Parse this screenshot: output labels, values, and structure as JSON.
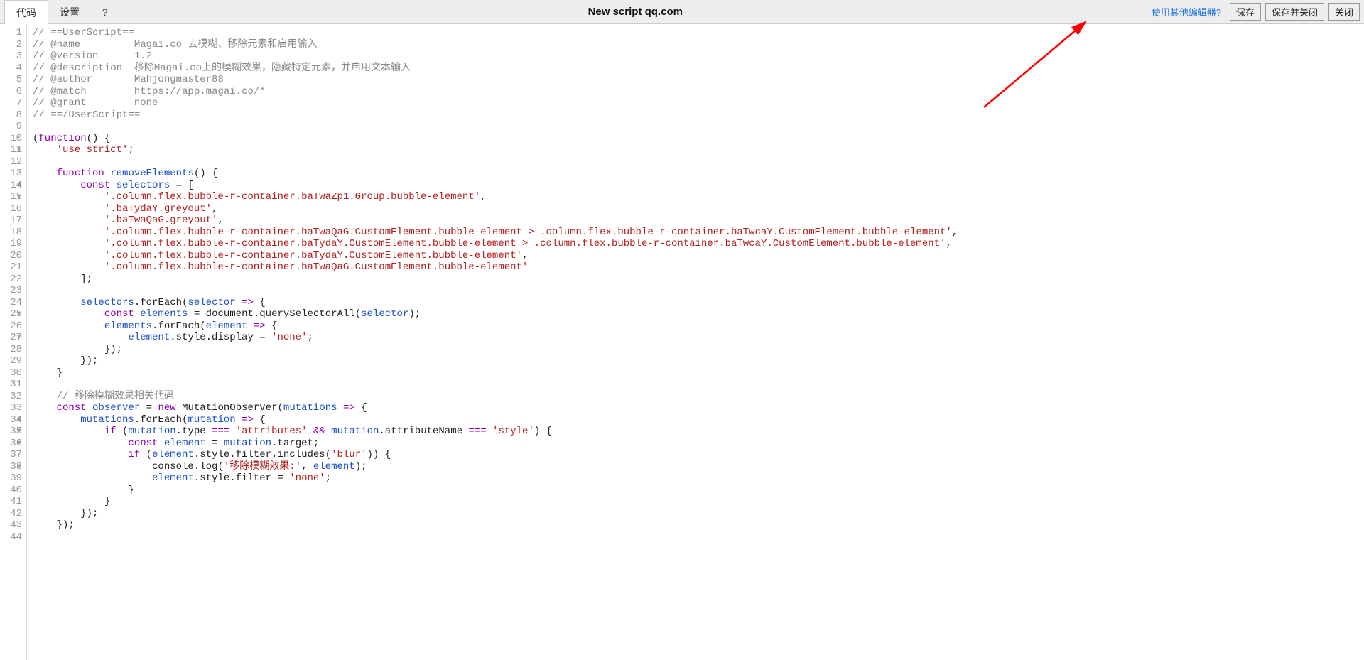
{
  "toolbar": {
    "tab_code": "代码",
    "tab_settings": "设置",
    "tab_help": "?",
    "title": "New script qq.com",
    "alt_editor_link": "使用其他编辑器?",
    "btn_save": "保存",
    "btn_save_close": "保存并关闭",
    "btn_close": "关闭"
  },
  "lines": [
    {
      "n": 1,
      "fold": false,
      "tokens": [
        [
          "com",
          "// ==UserScript=="
        ]
      ]
    },
    {
      "n": 2,
      "fold": false,
      "tokens": [
        [
          "com",
          "// @name         Magai.co 去模糊、移除元素和启用输入"
        ]
      ]
    },
    {
      "n": 3,
      "fold": false,
      "tokens": [
        [
          "com",
          "// @version      1.2"
        ]
      ]
    },
    {
      "n": 4,
      "fold": false,
      "tokens": [
        [
          "com",
          "// @description  移除Magai.co上的模糊效果，隐藏特定元素，并启用文本输入"
        ]
      ]
    },
    {
      "n": 5,
      "fold": false,
      "tokens": [
        [
          "com",
          "// @author       Mahjongmaster88"
        ]
      ]
    },
    {
      "n": 6,
      "fold": false,
      "tokens": [
        [
          "com",
          "// @match        https://app.magai.co/*"
        ]
      ]
    },
    {
      "n": 7,
      "fold": false,
      "tokens": [
        [
          "com",
          "// @grant        none"
        ]
      ]
    },
    {
      "n": 8,
      "fold": false,
      "tokens": [
        [
          "com",
          "// ==/UserScript=="
        ]
      ]
    },
    {
      "n": 9,
      "fold": false,
      "tokens": []
    },
    {
      "n": 10,
      "fold": true,
      "tokens": [
        [
          "p",
          "("
        ],
        [
          "kw",
          "function"
        ],
        [
          "p",
          "() {"
        ]
      ]
    },
    {
      "n": 11,
      "fold": false,
      "tokens": [
        [
          "p",
          "    "
        ],
        [
          "str",
          "'use strict'"
        ],
        [
          "p",
          ";"
        ]
      ]
    },
    {
      "n": 12,
      "fold": false,
      "tokens": []
    },
    {
      "n": 13,
      "fold": true,
      "tokens": [
        [
          "p",
          "    "
        ],
        [
          "kw",
          "function"
        ],
        [
          "p",
          " "
        ],
        [
          "def",
          "removeElements"
        ],
        [
          "p",
          "() {"
        ]
      ]
    },
    {
      "n": 14,
      "fold": true,
      "tokens": [
        [
          "p",
          "        "
        ],
        [
          "kw",
          "const"
        ],
        [
          "p",
          " "
        ],
        [
          "def",
          "selectors"
        ],
        [
          "p",
          " = ["
        ]
      ]
    },
    {
      "n": 15,
      "fold": false,
      "tokens": [
        [
          "p",
          "            "
        ],
        [
          "str",
          "'.column.flex.bubble-r-container.baTwaZp1.Group.bubble-element'"
        ],
        [
          "p",
          ","
        ]
      ]
    },
    {
      "n": 16,
      "fold": false,
      "tokens": [
        [
          "p",
          "            "
        ],
        [
          "str",
          "'.baTydaY.greyout'"
        ],
        [
          "p",
          ","
        ]
      ]
    },
    {
      "n": 17,
      "fold": false,
      "tokens": [
        [
          "p",
          "            "
        ],
        [
          "str",
          "'.baTwaQaG.greyout'"
        ],
        [
          "p",
          ","
        ]
      ]
    },
    {
      "n": 18,
      "fold": false,
      "tokens": [
        [
          "p",
          "            "
        ],
        [
          "str",
          "'.column.flex.bubble-r-container.baTwaQaG.CustomElement.bubble-element > .column.flex.bubble-r-container.baTwcaY.CustomElement.bubble-element'"
        ],
        [
          "p",
          ","
        ]
      ]
    },
    {
      "n": 19,
      "fold": false,
      "tokens": [
        [
          "p",
          "            "
        ],
        [
          "str",
          "'.column.flex.bubble-r-container.baTydaY.CustomElement.bubble-element > .column.flex.bubble-r-container.baTwcaY.CustomElement.bubble-element'"
        ],
        [
          "p",
          ","
        ]
      ]
    },
    {
      "n": 20,
      "fold": false,
      "tokens": [
        [
          "p",
          "            "
        ],
        [
          "str",
          "'.column.flex.bubble-r-container.baTydaY.CustomElement.bubble-element'"
        ],
        [
          "p",
          ","
        ]
      ]
    },
    {
      "n": 21,
      "fold": false,
      "tokens": [
        [
          "p",
          "            "
        ],
        [
          "str",
          "'.column.flex.bubble-r-container.baTwaQaG.CustomElement.bubble-element'"
        ]
      ]
    },
    {
      "n": 22,
      "fold": false,
      "tokens": [
        [
          "p",
          "        ];"
        ]
      ]
    },
    {
      "n": 23,
      "fold": false,
      "tokens": []
    },
    {
      "n": 24,
      "fold": true,
      "tokens": [
        [
          "p",
          "        "
        ],
        [
          "var",
          "selectors"
        ],
        [
          "p",
          "."
        ],
        [
          "prop",
          "forEach"
        ],
        [
          "p",
          "("
        ],
        [
          "def",
          "selector"
        ],
        [
          "p",
          " "
        ],
        [
          "kw",
          "=>"
        ],
        [
          "p",
          " {"
        ]
      ]
    },
    {
      "n": 25,
      "fold": false,
      "tokens": [
        [
          "p",
          "            "
        ],
        [
          "kw",
          "const"
        ],
        [
          "p",
          " "
        ],
        [
          "def",
          "elements"
        ],
        [
          "p",
          " = document.querySelectorAll("
        ],
        [
          "var",
          "selector"
        ],
        [
          "p",
          ");"
        ]
      ]
    },
    {
      "n": 26,
      "fold": true,
      "tokens": [
        [
          "p",
          "            "
        ],
        [
          "var",
          "elements"
        ],
        [
          "p",
          "."
        ],
        [
          "prop",
          "forEach"
        ],
        [
          "p",
          "("
        ],
        [
          "def",
          "element"
        ],
        [
          "p",
          " "
        ],
        [
          "kw",
          "=>"
        ],
        [
          "p",
          " {"
        ]
      ]
    },
    {
      "n": 27,
      "fold": false,
      "tokens": [
        [
          "p",
          "                "
        ],
        [
          "var",
          "element"
        ],
        [
          "p",
          ".style.display = "
        ],
        [
          "str",
          "'none'"
        ],
        [
          "p",
          ";"
        ]
      ]
    },
    {
      "n": 28,
      "fold": false,
      "tokens": [
        [
          "p",
          "            });"
        ]
      ]
    },
    {
      "n": 29,
      "fold": false,
      "tokens": [
        [
          "p",
          "        });"
        ]
      ]
    },
    {
      "n": 30,
      "fold": false,
      "tokens": [
        [
          "p",
          "    }"
        ]
      ]
    },
    {
      "n": 31,
      "fold": false,
      "tokens": []
    },
    {
      "n": 32,
      "fold": false,
      "tokens": [
        [
          "p",
          "    "
        ],
        [
          "com",
          "// 移除模糊效果相关代码"
        ]
      ]
    },
    {
      "n": 33,
      "fold": true,
      "tokens": [
        [
          "p",
          "    "
        ],
        [
          "kw",
          "const"
        ],
        [
          "p",
          " "
        ],
        [
          "def",
          "observer"
        ],
        [
          "p",
          " = "
        ],
        [
          "kw",
          "new"
        ],
        [
          "p",
          " MutationObserver("
        ],
        [
          "def",
          "mutations"
        ],
        [
          "p",
          " "
        ],
        [
          "kw",
          "=>"
        ],
        [
          "p",
          " {"
        ]
      ]
    },
    {
      "n": 34,
      "fold": true,
      "tokens": [
        [
          "p",
          "        "
        ],
        [
          "var",
          "mutations"
        ],
        [
          "p",
          "."
        ],
        [
          "prop",
          "forEach"
        ],
        [
          "p",
          "("
        ],
        [
          "def",
          "mutation"
        ],
        [
          "p",
          " "
        ],
        [
          "kw",
          "=>"
        ],
        [
          "p",
          " {"
        ]
      ]
    },
    {
      "n": 35,
      "fold": true,
      "tokens": [
        [
          "p",
          "            "
        ],
        [
          "kw",
          "if"
        ],
        [
          "p",
          " ("
        ],
        [
          "var",
          "mutation"
        ],
        [
          "p",
          ".type "
        ],
        [
          "kw",
          "==="
        ],
        [
          "p",
          " "
        ],
        [
          "str",
          "'attributes'"
        ],
        [
          "p",
          " "
        ],
        [
          "kw",
          "&&"
        ],
        [
          "p",
          " "
        ],
        [
          "var",
          "mutation"
        ],
        [
          "p",
          ".attributeName "
        ],
        [
          "kw",
          "==="
        ],
        [
          "p",
          " "
        ],
        [
          "str",
          "'style'"
        ],
        [
          "p",
          ") {"
        ]
      ]
    },
    {
      "n": 36,
      "fold": false,
      "tokens": [
        [
          "p",
          "                "
        ],
        [
          "kw",
          "const"
        ],
        [
          "p",
          " "
        ],
        [
          "def",
          "element"
        ],
        [
          "p",
          " = "
        ],
        [
          "var",
          "mutation"
        ],
        [
          "p",
          ".target;"
        ]
      ]
    },
    {
      "n": 37,
      "fold": true,
      "tokens": [
        [
          "p",
          "                "
        ],
        [
          "kw",
          "if"
        ],
        [
          "p",
          " ("
        ],
        [
          "var",
          "element"
        ],
        [
          "p",
          ".style.filter.includes("
        ],
        [
          "str",
          "'blur'"
        ],
        [
          "p",
          ")) {"
        ]
      ]
    },
    {
      "n": 38,
      "fold": false,
      "tokens": [
        [
          "p",
          "                    console.log("
        ],
        [
          "str",
          "'移除模糊效果:'"
        ],
        [
          "p",
          ", "
        ],
        [
          "var",
          "element"
        ],
        [
          "p",
          ");"
        ]
      ]
    },
    {
      "n": 39,
      "fold": false,
      "tokens": [
        [
          "p",
          "                    "
        ],
        [
          "var",
          "element"
        ],
        [
          "p",
          ".style.filter = "
        ],
        [
          "str",
          "'none'"
        ],
        [
          "p",
          ";"
        ]
      ]
    },
    {
      "n": 40,
      "fold": false,
      "tokens": [
        [
          "p",
          "                }"
        ]
      ]
    },
    {
      "n": 41,
      "fold": false,
      "tokens": [
        [
          "p",
          "            }"
        ]
      ]
    },
    {
      "n": 42,
      "fold": false,
      "tokens": [
        [
          "p",
          "        });"
        ]
      ]
    },
    {
      "n": 43,
      "fold": false,
      "tokens": [
        [
          "p",
          "    });"
        ]
      ]
    },
    {
      "n": 44,
      "fold": false,
      "tokens": []
    }
  ]
}
